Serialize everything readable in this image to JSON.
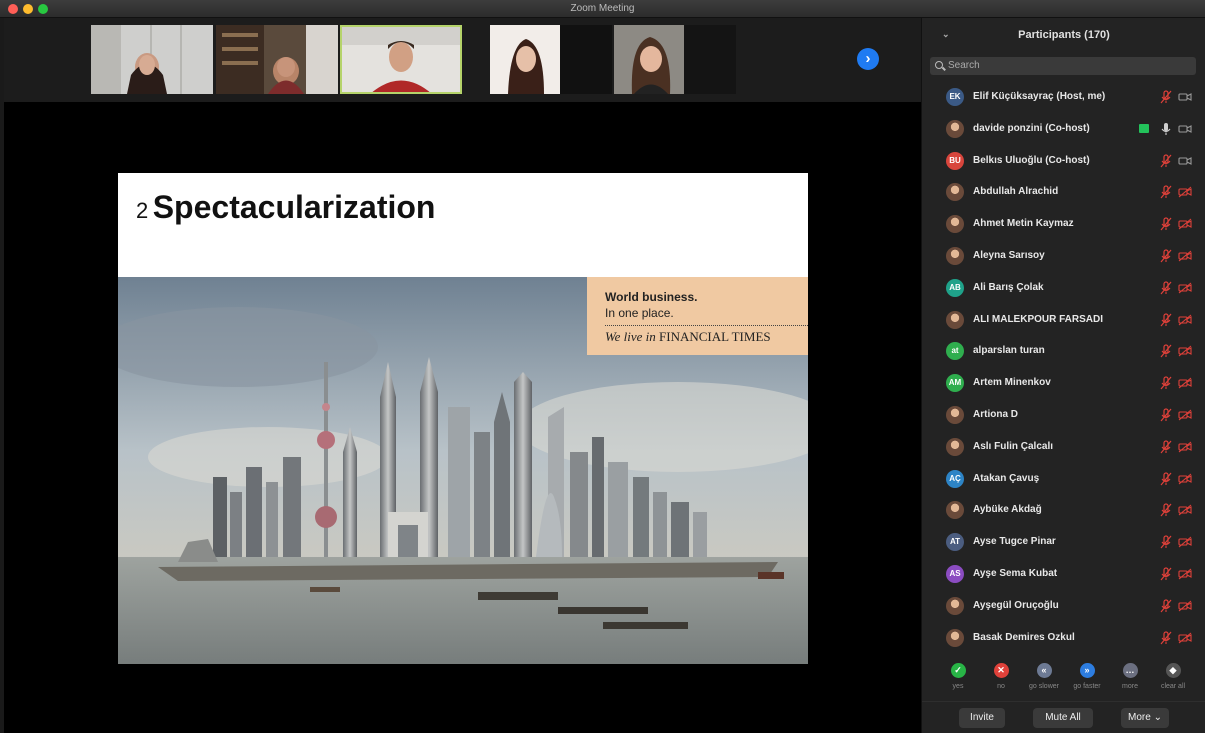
{
  "window": {
    "title": "Zoom Meeting"
  },
  "slide": {
    "number": "2",
    "title": "Spectacularization",
    "ad": {
      "line1": "World business.",
      "line2": "In one place.",
      "line3_italic": "We live in",
      "line3_brand": "FINANCIAL TIMES"
    }
  },
  "panel": {
    "title": "Participants (170)",
    "search_placeholder": "Search",
    "participants": [
      {
        "initials": "EK",
        "name": "Elif Küçüksayraç (Host, me)",
        "avatar_color": "#3b5a86",
        "mic": "muted",
        "cam": "on"
      },
      {
        "initials": "",
        "name": "davide ponzini (Co-host)",
        "avatar_color": "",
        "mic": "on",
        "cam": "on",
        "sharing": true
      },
      {
        "initials": "BU",
        "name": "Belkıs Uluoğlu (Co-host)",
        "avatar_color": "#d8453c",
        "mic": "muted",
        "cam": "on"
      },
      {
        "initials": "",
        "name": "Abdullah Alrachid",
        "avatar_color": "",
        "mic": "muted",
        "cam": "off"
      },
      {
        "initials": "",
        "name": "Ahmet Metin Kaymaz",
        "avatar_color": "",
        "mic": "muted",
        "cam": "off"
      },
      {
        "initials": "",
        "name": "Aleyna Sarısoy",
        "avatar_color": "",
        "mic": "muted",
        "cam": "off"
      },
      {
        "initials": "AB",
        "name": "Ali Barış Çolak",
        "avatar_color": "#1fa28a",
        "mic": "muted",
        "cam": "off"
      },
      {
        "initials": "",
        "name": "ALI MALEKPOUR FARSADI",
        "avatar_color": "",
        "mic": "muted",
        "cam": "off"
      },
      {
        "initials": "at",
        "name": "alparslan turan",
        "avatar_color": "#2fae4e",
        "mic": "muted",
        "cam": "off"
      },
      {
        "initials": "AM",
        "name": "Artem Minenkov",
        "avatar_color": "#2fae4e",
        "mic": "muted",
        "cam": "off"
      },
      {
        "initials": "",
        "name": "Artiona D",
        "avatar_color": "",
        "mic": "muted",
        "cam": "off"
      },
      {
        "initials": "",
        "name": "Aslı Fulin Çalcalı",
        "avatar_color": "",
        "mic": "muted",
        "cam": "off"
      },
      {
        "initials": "AÇ",
        "name": "Atakan Çavuş",
        "avatar_color": "#2d84c6",
        "mic": "muted",
        "cam": "off"
      },
      {
        "initials": "",
        "name": "Aybüke Akdağ",
        "avatar_color": "",
        "mic": "muted",
        "cam": "off"
      },
      {
        "initials": "AT",
        "name": "Ayse Tugce Pinar",
        "avatar_color": "#4b5d80",
        "mic": "muted",
        "cam": "off"
      },
      {
        "initials": "AS",
        "name": "Ayşe Sema Kubat",
        "avatar_color": "#8b4cc1",
        "mic": "muted",
        "cam": "off"
      },
      {
        "initials": "",
        "name": "Ayşegül Oruçoğlu",
        "avatar_color": "",
        "mic": "muted",
        "cam": "off"
      },
      {
        "initials": "",
        "name": "Basak Demires Ozkul",
        "avatar_color": "",
        "mic": "muted",
        "cam": "off"
      }
    ],
    "reactions": [
      {
        "label": "yes",
        "icon": "check-icon",
        "color": "#28b446"
      },
      {
        "label": "no",
        "icon": "x-icon",
        "color": "#e0413a"
      },
      {
        "label": "go slower",
        "icon": "rewind-icon",
        "color": "#6d7a94"
      },
      {
        "label": "go faster",
        "icon": "fast-forward-icon",
        "color": "#2d7de0"
      },
      {
        "label": "more",
        "icon": "ellipsis-icon",
        "color": "#6b6f80"
      },
      {
        "label": "clear all",
        "icon": "eraser-icon",
        "color": "#555555"
      }
    ],
    "buttons": {
      "invite": "Invite",
      "mute_all": "Mute All",
      "more": "More"
    }
  },
  "colors": {
    "muted_red": "#e0413a",
    "active_border": "#b5d36a",
    "accent_blue": "#1f7bf2"
  }
}
